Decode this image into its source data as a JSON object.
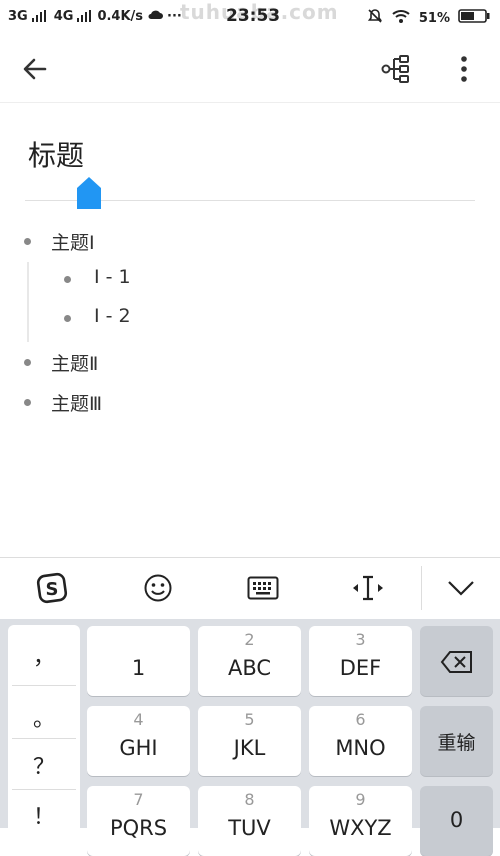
{
  "status_bar": {
    "net1": "3G",
    "net2": "4G",
    "speed": "0.4K/s",
    "more": "···",
    "time": "23:53",
    "battery": "51%",
    "watermark": "tuhuaba.com"
  },
  "app_bar": {
    "back_icon": "arrow-left-icon",
    "mindmap_icon": "mindmap-tree-icon",
    "more_icon": "more-vertical-icon"
  },
  "document": {
    "title": "标题",
    "items": [
      {
        "label": "主题Ⅰ"
      },
      {
        "label": "Ⅰ - 1"
      },
      {
        "label": "Ⅰ - 2"
      },
      {
        "label": "主题Ⅱ"
      },
      {
        "label": "主题Ⅲ"
      }
    ]
  },
  "ime_toolbar": {
    "icons": [
      "sogou-logo-icon",
      "emoji-icon",
      "keyboard-icon",
      "cursor-move-icon",
      "chevron-down-icon"
    ]
  },
  "keyboard": {
    "punctuation": [
      "，",
      "。",
      "？",
      "！"
    ],
    "keys": [
      {
        "num": "",
        "label": "1"
      },
      {
        "num": "2",
        "label": "ABC"
      },
      {
        "num": "3",
        "label": "DEF"
      },
      {
        "num": "4",
        "label": "GHI"
      },
      {
        "num": "5",
        "label": "JKL"
      },
      {
        "num": "6",
        "label": "MNO"
      },
      {
        "num": "7",
        "label": "PQRS"
      },
      {
        "num": "8",
        "label": "TUV"
      },
      {
        "num": "9",
        "label": "WXYZ"
      }
    ],
    "delete_icon": "backspace-icon",
    "retype_label": "重输",
    "zero_label": "0"
  }
}
